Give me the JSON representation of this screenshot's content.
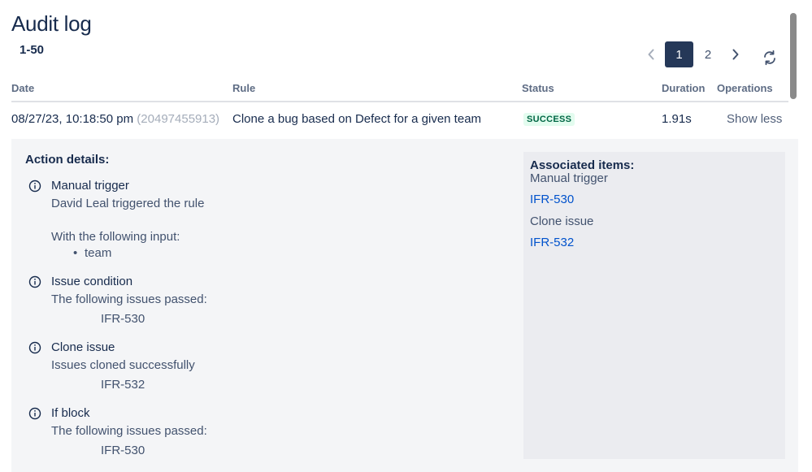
{
  "page": {
    "title": "Audit log",
    "range": "1-50"
  },
  "pagination": {
    "current": "1",
    "next_page": "2",
    "prev_icon": "chevron-left-icon",
    "next_icon": "chevron-right-icon"
  },
  "refresh_icon": "refresh-icon",
  "table": {
    "headers": {
      "date": "Date",
      "rule": "Rule",
      "status": "Status",
      "duration": "Duration",
      "operations": "Operations"
    },
    "row": {
      "date": "08/27/23, 10:18:50 pm",
      "execution_id": "(20497455913)",
      "rule": "Clone a bug based on Defect for a given team",
      "status": "SUCCESS",
      "duration": "1.91s",
      "operation": "Show less"
    }
  },
  "details": {
    "title": "Action details:",
    "actions": [
      {
        "name": "Manual trigger",
        "desc": "David Leal triggered the rule",
        "input_label": "With the following input:",
        "input_item": "team"
      },
      {
        "name": "Issue condition",
        "desc": "The following issues passed:",
        "key": "IFR-530"
      },
      {
        "name": "Clone issue",
        "desc": "Issues cloned successfully",
        "key": "IFR-532"
      },
      {
        "name": "If block",
        "desc": "The following issues passed:",
        "key": "IFR-530"
      }
    ],
    "associated": {
      "title": "Associated items:",
      "groups": [
        {
          "label": "Manual trigger",
          "link": "IFR-530"
        },
        {
          "label": "Clone issue",
          "link": "IFR-532"
        }
      ]
    }
  },
  "colors": {
    "text": "#172B4D",
    "link": "#0052CC",
    "success_bg": "#E3FCEF",
    "success_text": "#006644",
    "page_selected": "#253858"
  }
}
